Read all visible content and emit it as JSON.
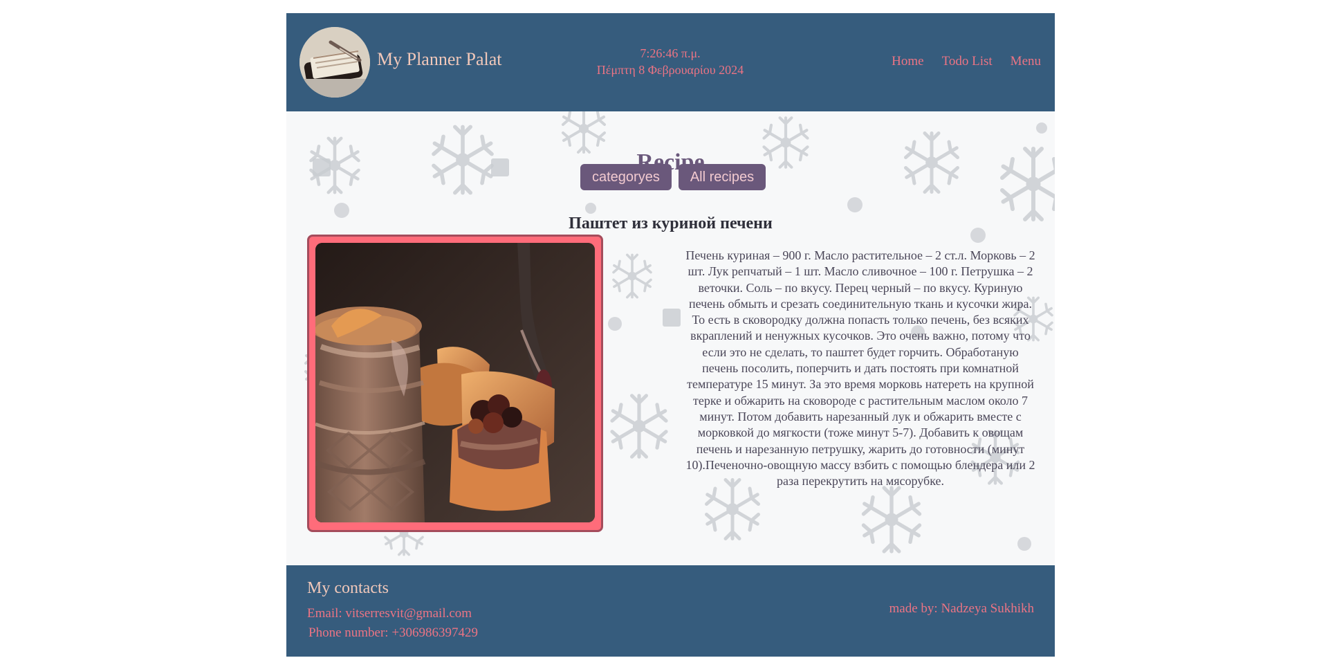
{
  "header": {
    "site_title": "My Planner Palat",
    "time": "7:26:46 π.μ.",
    "date": "Πέμπτη 8 Φεβρουαρίου 2024",
    "nav": [
      "Home",
      "Todo List",
      "Menu"
    ]
  },
  "main": {
    "heading": "Recipe",
    "buttons": [
      "categoryes",
      "All recipes"
    ],
    "recipe_title": "Паштет из куриной печени",
    "recipe_text": "Печень куриная – 900 г. Масло растительное – 2 ст.л. Морковь – 2 шт. Лук репчатый – 1 шт. Масло сливочное – 100 г. Петрушка – 2 веточки. Соль – по вкусу. Перец черный – по вкусу. Куриную печень обмыть и срезать соединительную ткань и кусочки жира. То есть в сковородку должна попасть только печень, без всяких вкраплений и ненужных кусочков. Это очень важно, потому что если это не сделать, то паштет будет горчить. Обработаную печень посолить, поперчить и дать постоять при комнатной температуре 15 минут. За это время морковь натереть на крупной терке и обжарить на сковороде с растительным маслом около 7 минут. Потом добавить нарезанный лук и обжарить вместе с морковкой до мягкости (тоже минут 5-7). Добавить к овощам печень и нарезанную петрушку, жарить до готовности (минут 10).Печеночно-овощную массу взбить с помощью блендера или 2 раза перекрутить на мясорубке."
  },
  "footer": {
    "contacts_title": "My contacts",
    "email": "Email: vitserresvit@gmail.com",
    "phone": "Phone number: +306986397429",
    "author": "made by: Nadzeya Sukhikh"
  },
  "colors": {
    "header_background": "#365c7d",
    "footer_background": "#365c7d",
    "accent_pink": "#ec7484",
    "button_purple": "#6a587b",
    "image_frame": "#ff6c7a"
  },
  "icons": [
    "planner-logo-icon",
    "snowflake-background-icon",
    "chicken-liver-pate-photo"
  ]
}
